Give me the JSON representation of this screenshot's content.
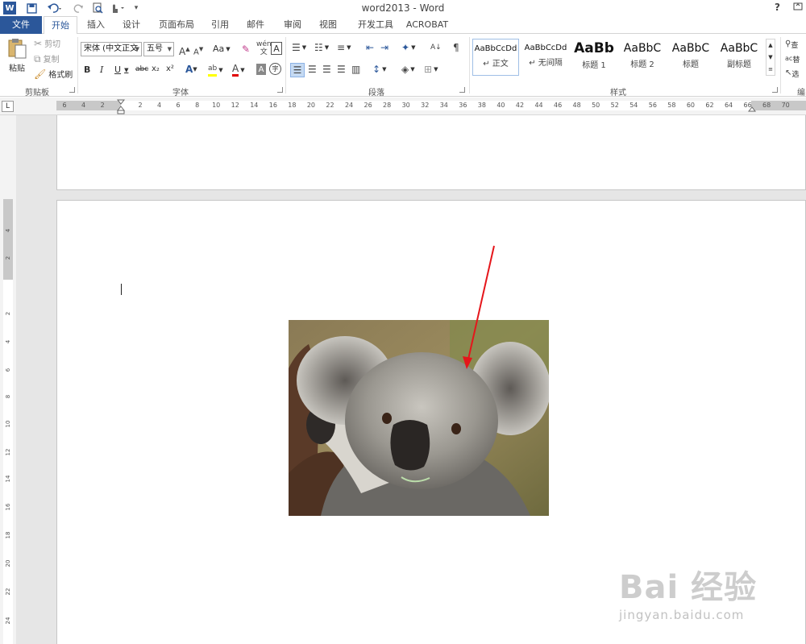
{
  "window": {
    "title": "word2013 - Word",
    "help": "?"
  },
  "quick_access": {
    "word_icon": "W",
    "save": "save-icon",
    "undo": "undo-icon",
    "redo": "redo-icon",
    "preview": "print-preview-icon",
    "touch": "touch-mode-icon",
    "customize": "customize-icon"
  },
  "tabs": [
    "文件",
    "开始",
    "插入",
    "设计",
    "页面布局",
    "引用",
    "邮件",
    "审阅",
    "视图",
    "开发工具",
    "ACROBAT"
  ],
  "ribbon": {
    "clipboard": {
      "label": "剪贴板",
      "paste": "粘贴",
      "cut": "剪切",
      "copy": "复制",
      "format_painter": "格式刷"
    },
    "font": {
      "label": "字体",
      "font_name": "宋体 (中文正文",
      "font_size": "五号",
      "change_case": "Aa",
      "bold": "B",
      "italic": "I",
      "underline": "U",
      "strike": "abc",
      "subscript": "x₂",
      "superscript": "x²",
      "char_border": "A"
    },
    "paragraph": {
      "label": "段落"
    },
    "styles": {
      "label": "样式",
      "items": [
        {
          "sample": "AaBbCcDd",
          "name": "↵ 正文"
        },
        {
          "sample": "AaBbCcDd",
          "name": "↵ 无间隔"
        },
        {
          "sample": "AaBb",
          "name": "标题 1"
        },
        {
          "sample": "AaBbC",
          "name": "标题 2"
        },
        {
          "sample": "AaBbC",
          "name": "标题"
        },
        {
          "sample": "AaBbC",
          "name": "副标题"
        }
      ]
    },
    "editing": {
      "label": "编",
      "find": "查",
      "replace": "替",
      "select": "选"
    }
  },
  "ruler": {
    "corner": "L",
    "horizontal_ticks": [
      "6",
      "4",
      "2",
      "2",
      "4",
      "6",
      "8",
      "10",
      "12",
      "14",
      "16",
      "18",
      "20",
      "22",
      "24",
      "26",
      "28",
      "30",
      "32",
      "34",
      "36",
      "38",
      "40",
      "42",
      "44",
      "46",
      "48",
      "50",
      "52",
      "54",
      "56",
      "58",
      "60",
      "62",
      "64",
      "66",
      "68",
      "70",
      "72"
    ],
    "vertical_ticks": [
      "4",
      "2",
      "2",
      "4",
      "6",
      "8",
      "10",
      "12",
      "14",
      "16",
      "18",
      "20",
      "22",
      "24"
    ]
  },
  "document": {
    "image_alt": "koala photo",
    "annotation": "red-arrow"
  },
  "watermark": {
    "main": "Bai 经验",
    "sub": "jingyan.baidu.com"
  }
}
